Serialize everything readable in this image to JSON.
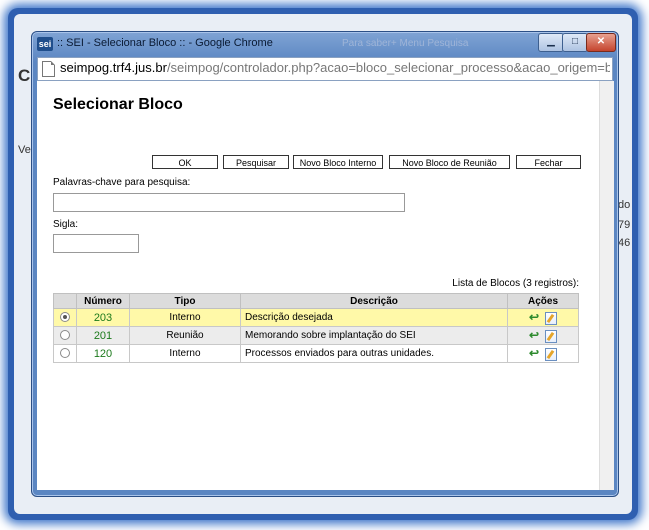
{
  "window": {
    "title": ":: SEI - Selecionar Bloco :: - Google Chrome",
    "logo_text": "sei",
    "title_ghost": "Para saber+  Menu  Pesquisa",
    "minimize": "▁",
    "maximize": "□",
    "close": "✕"
  },
  "address": {
    "host": "seimpog.trf4.jus.br",
    "path": "/seimpog/controlador.php?acao=bloco_selecionar_processo&acao_origem=bl"
  },
  "background": {
    "frag1": "C",
    "frag2": "Ve",
    "frag3": "do",
    "frag4": "79",
    "frag5": "46"
  },
  "page": {
    "title": "Selecionar Bloco",
    "buttons": {
      "ok": "OK",
      "pesquisar": "Pesquisar",
      "novo_interno": "Novo Bloco Interno",
      "novo_reuniao": "Novo Bloco de Reunião",
      "fechar": "Fechar"
    },
    "palavras_label": "Palavras-chave para pesquisa:",
    "palavras_value": "",
    "sigla_label": "Sigla:",
    "sigla_value": "",
    "caption": "Lista de Blocos (3 registros):"
  },
  "table": {
    "headers": [
      "",
      "Número",
      "Tipo",
      "Descrição",
      "Ações"
    ],
    "rows": [
      {
        "selected": true,
        "numero": "203",
        "tipo": "Interno",
        "descricao": "Descrição desejada"
      },
      {
        "selected": false,
        "numero": "201",
        "tipo": "Reunião",
        "descricao": "Memorando sobre implantação do SEI"
      },
      {
        "selected": false,
        "numero": "120",
        "tipo": "Interno",
        "descricao": "Processos enviados para outras unidades."
      }
    ],
    "action_icon": "↩"
  },
  "colors": {
    "selected_row": "#fff9a8",
    "number_text": "#1c7a1c",
    "frame_blue": "#2f5fb0"
  }
}
